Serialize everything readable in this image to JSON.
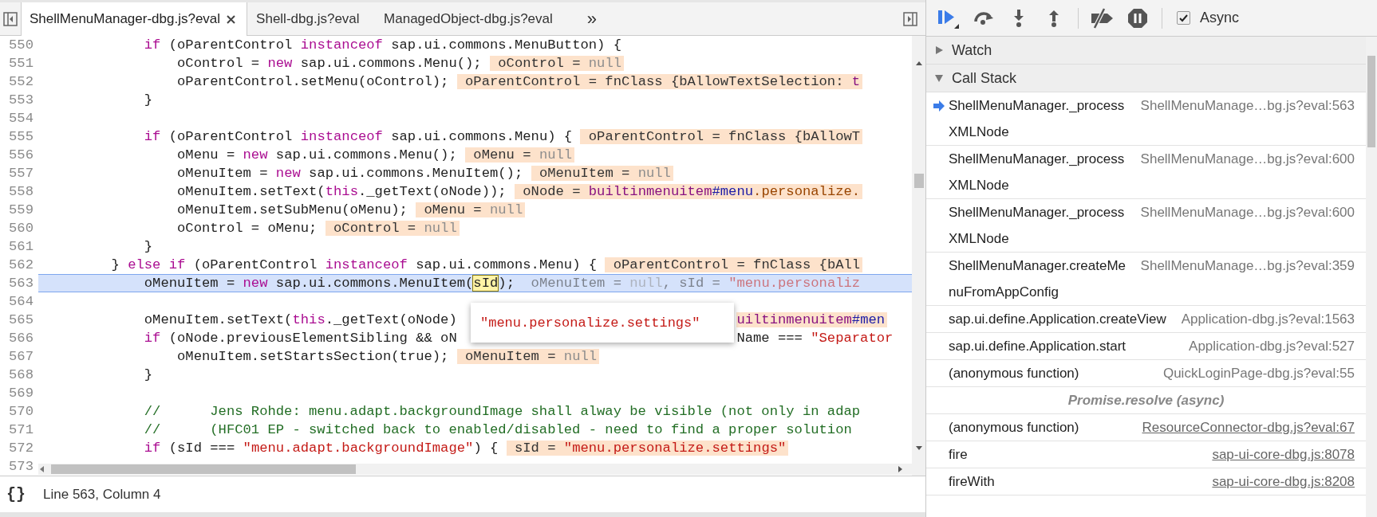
{
  "editor": {
    "tabs": [
      {
        "label": "ShellMenuManager-dbg.js?eval",
        "selected": true
      },
      {
        "label": "Shell-dbg.js?eval",
        "selected": false
      },
      {
        "label": "ManagedObject-dbg.js?eval",
        "selected": false
      }
    ],
    "overflow_label": "»",
    "lines": [
      {
        "number": "550",
        "current": false,
        "tokens": [
          {
            "kind": "kw",
            "text": "            if"
          },
          {
            "kind": "plain",
            "text": " (oParentControl "
          },
          {
            "kind": "kw",
            "text": "instanceof"
          },
          {
            "kind": "plain",
            "text": " sap.ui.commons.MenuButton) {"
          }
        ]
      },
      {
        "number": "551",
        "current": false,
        "tokens": [
          {
            "kind": "plain",
            "text": "                oControl = "
          },
          {
            "kind": "kw",
            "text": "new"
          },
          {
            "kind": "plain",
            "text": " sap.ui.commons.Menu(); "
          },
          {
            "kind": "ann-name",
            "text": " oControl = "
          },
          {
            "kind": "ann-null",
            "text": "null"
          }
        ]
      },
      {
        "number": "552",
        "current": false,
        "tokens": [
          {
            "kind": "plain",
            "text": "                oParentControl.setMenu(oControl); "
          },
          {
            "kind": "ann-name",
            "text": " oParentControl = fnClass {bAllowTextSelection: "
          },
          {
            "kind": "ann-tag",
            "text": "t"
          }
        ]
      },
      {
        "number": "553",
        "current": false,
        "tokens": [
          {
            "kind": "plain",
            "text": "            }"
          }
        ]
      },
      {
        "number": "554",
        "current": false
      },
      {
        "number": "555",
        "current": false,
        "tokens": [
          {
            "kind": "kw",
            "text": "            if"
          },
          {
            "kind": "plain",
            "text": " (oParentControl "
          },
          {
            "kind": "kw",
            "text": "instanceof"
          },
          {
            "kind": "plain",
            "text": " sap.ui.commons.Menu) { "
          },
          {
            "kind": "ann-name",
            "text": " oParentControl = fnClass {bAllowT"
          }
        ]
      },
      {
        "number": "556",
        "current": false,
        "tokens": [
          {
            "kind": "plain",
            "text": "                oMenu = "
          },
          {
            "kind": "kw",
            "text": "new"
          },
          {
            "kind": "plain",
            "text": " sap.ui.commons.Menu(); "
          },
          {
            "kind": "ann-name",
            "text": " oMenu = "
          },
          {
            "kind": "ann-null",
            "text": "null"
          }
        ]
      },
      {
        "number": "557",
        "current": false,
        "tokens": [
          {
            "kind": "plain",
            "text": "                oMenuItem = "
          },
          {
            "kind": "kw",
            "text": "new"
          },
          {
            "kind": "plain",
            "text": " sap.ui.commons.MenuItem(); "
          },
          {
            "kind": "ann-name",
            "text": " oMenuItem = "
          },
          {
            "kind": "ann-null",
            "text": "null"
          }
        ]
      },
      {
        "number": "558",
        "current": false,
        "tokens": [
          {
            "kind": "plain",
            "text": "                oMenuItem.setText("
          },
          {
            "kind": "kw",
            "text": "this"
          },
          {
            "kind": "plain",
            "text": "._getText(oNode)); "
          },
          {
            "kind": "ann-name",
            "text": " oNode = "
          },
          {
            "kind": "ann-tag",
            "text": "builtinmenuitem"
          },
          {
            "kind": "ann-hash",
            "text": "#menu"
          },
          {
            "kind": "ann-class",
            "text": ".personalize."
          }
        ]
      },
      {
        "number": "559",
        "current": false,
        "tokens": [
          {
            "kind": "plain",
            "text": "                oMenuItem.setSubMenu(oMenu); "
          },
          {
            "kind": "ann-name",
            "text": " oMenu = "
          },
          {
            "kind": "ann-null",
            "text": "null"
          }
        ]
      },
      {
        "number": "560",
        "current": false,
        "tokens": [
          {
            "kind": "plain",
            "text": "                oControl = oMenu; "
          },
          {
            "kind": "ann-name",
            "text": " oControl = "
          },
          {
            "kind": "ann-null",
            "text": "null"
          }
        ]
      },
      {
        "number": "561",
        "current": false,
        "tokens": [
          {
            "kind": "plain",
            "text": "            }"
          }
        ]
      },
      {
        "number": "562",
        "current": false,
        "tokens": [
          {
            "kind": "plain",
            "text": "        } "
          },
          {
            "kind": "kw",
            "text": "else if"
          },
          {
            "kind": "plain",
            "text": " (oParentControl "
          },
          {
            "kind": "kw",
            "text": "instanceof"
          },
          {
            "kind": "plain",
            "text": " sap.ui.commons.Menu) { "
          },
          {
            "kind": "ann-name",
            "text": " oParentControl = fnClass {bAll"
          }
        ]
      },
      {
        "number": "563",
        "current": true,
        "tokens": [
          {
            "kind": "plain",
            "text": "            oMenuItem = "
          },
          {
            "kind": "kw",
            "text": "new"
          },
          {
            "kind": "plain",
            "text": " sap.ui.commons.MenuItem("
          },
          {
            "kind": "hover",
            "text": "sId"
          },
          {
            "kind": "plain",
            "text": "); "
          },
          {
            "kind": "ann-name",
            "text": " oMenuItem = "
          },
          {
            "kind": "ann-null",
            "text": "null"
          },
          {
            "kind": "ann-name",
            "text": ", sId = "
          },
          {
            "kind": "ann-str",
            "text": "\"menu.personaliz"
          }
        ]
      },
      {
        "number": "564",
        "current": false
      },
      {
        "number": "565",
        "current": false,
        "tokens": [
          {
            "kind": "plain",
            "text": "            oMenuItem.setText("
          },
          {
            "kind": "kw",
            "text": "this"
          },
          {
            "kind": "plain",
            "text": "._getText(oNode)"
          },
          {
            "kind": "covered"
          },
          {
            "kind": "ann-tag",
            "text": "uiltinmenuitem"
          },
          {
            "kind": "ann-hash",
            "text": "#men"
          }
        ]
      },
      {
        "number": "566",
        "current": false,
        "tokens": [
          {
            "kind": "kw",
            "text": "            if"
          },
          {
            "kind": "plain",
            "text": " (oNode.previousElementSibling && oN"
          },
          {
            "kind": "covered"
          },
          {
            "kind": "plain",
            "text": "Name === "
          },
          {
            "kind": "str",
            "text": "\"Separator"
          }
        ]
      },
      {
        "number": "567",
        "current": false,
        "tokens": [
          {
            "kind": "plain",
            "text": "                oMenuItem.setStartsSection(true); "
          },
          {
            "kind": "ann-name",
            "text": " oMenuItem = "
          },
          {
            "kind": "ann-null",
            "text": "null"
          }
        ]
      },
      {
        "number": "568",
        "current": false,
        "tokens": [
          {
            "kind": "plain",
            "text": "            }"
          }
        ]
      },
      {
        "number": "569",
        "current": false
      },
      {
        "number": "570",
        "current": false,
        "tokens": [
          {
            "kind": "cm",
            "text": "            //      Jens Rohde: menu.adapt.backgroundImage shall alway be visible (not only in adap"
          }
        ]
      },
      {
        "number": "571",
        "current": false,
        "tokens": [
          {
            "kind": "cm",
            "text": "            //      (HFC01 EP - switched back to enabled/disabled - need to find a proper solution"
          }
        ]
      },
      {
        "number": "572",
        "current": false,
        "tokens": [
          {
            "kind": "kw",
            "text": "            if"
          },
          {
            "kind": "plain",
            "text": " (sId === "
          },
          {
            "kind": "str",
            "text": "\"menu.adapt.backgroundImage\""
          },
          {
            "kind": "plain",
            "text": ") { "
          },
          {
            "kind": "ann-name",
            "text": " sId = "
          },
          {
            "kind": "ann-str",
            "text": "\"menu.personalize.settings\""
          }
        ]
      },
      {
        "number": "573",
        "current": false
      }
    ],
    "popover": {
      "text": "\"menu.personalize.settings\""
    },
    "status_bar": {
      "format_label": "{}",
      "position": "Line 563, Column 4"
    }
  },
  "debugger": {
    "async": {
      "label": "Async",
      "checked": true
    },
    "sections": [
      {
        "title": "Watch",
        "expanded": false
      },
      {
        "title": "Call Stack",
        "expanded": true
      }
    ],
    "call_stack": [
      {
        "kind": "frame",
        "name": "ShellMenuManager._processXMLNode",
        "location": "ShellMenuManage…bg.js?eval:563",
        "current": true,
        "link": false
      },
      {
        "kind": "frame",
        "name": "ShellMenuManager._processXMLNode",
        "location": "ShellMenuManage…bg.js?eval:600",
        "current": false,
        "link": false
      },
      {
        "kind": "frame",
        "name": "ShellMenuManager._processXMLNode",
        "location": "ShellMenuManage…bg.js?eval:600",
        "current": false,
        "link": false
      },
      {
        "kind": "frame",
        "name": "ShellMenuManager.createMenuFromAppConfig",
        "location": "ShellMenuManage…bg.js?eval:359",
        "current": false,
        "link": false
      },
      {
        "kind": "frame",
        "name": "sap.ui.define.Application.createView",
        "location": "Application-dbg.js?eval:1563",
        "current": false,
        "link": false
      },
      {
        "kind": "frame",
        "name": "sap.ui.define.Application.start",
        "location": "Application-dbg.js?eval:527",
        "current": false,
        "link": false
      },
      {
        "kind": "frame",
        "name": "(anonymous function)",
        "location": "QuickLoginPage-dbg.js?eval:55",
        "current": false,
        "link": false
      },
      {
        "kind": "async",
        "label": "Promise.resolve (async)"
      },
      {
        "kind": "frame",
        "name": "(anonymous function)",
        "location": "ResourceConnector-dbg.js?eval:67",
        "current": false,
        "link": true
      },
      {
        "kind": "frame",
        "name": "fire",
        "location": "sap-ui-core-dbg.js:8078",
        "current": false,
        "link": true
      },
      {
        "kind": "frame",
        "name": "fireWith",
        "location": "sap-ui-core-dbg.js:8208",
        "current": false,
        "link": true
      }
    ]
  }
}
